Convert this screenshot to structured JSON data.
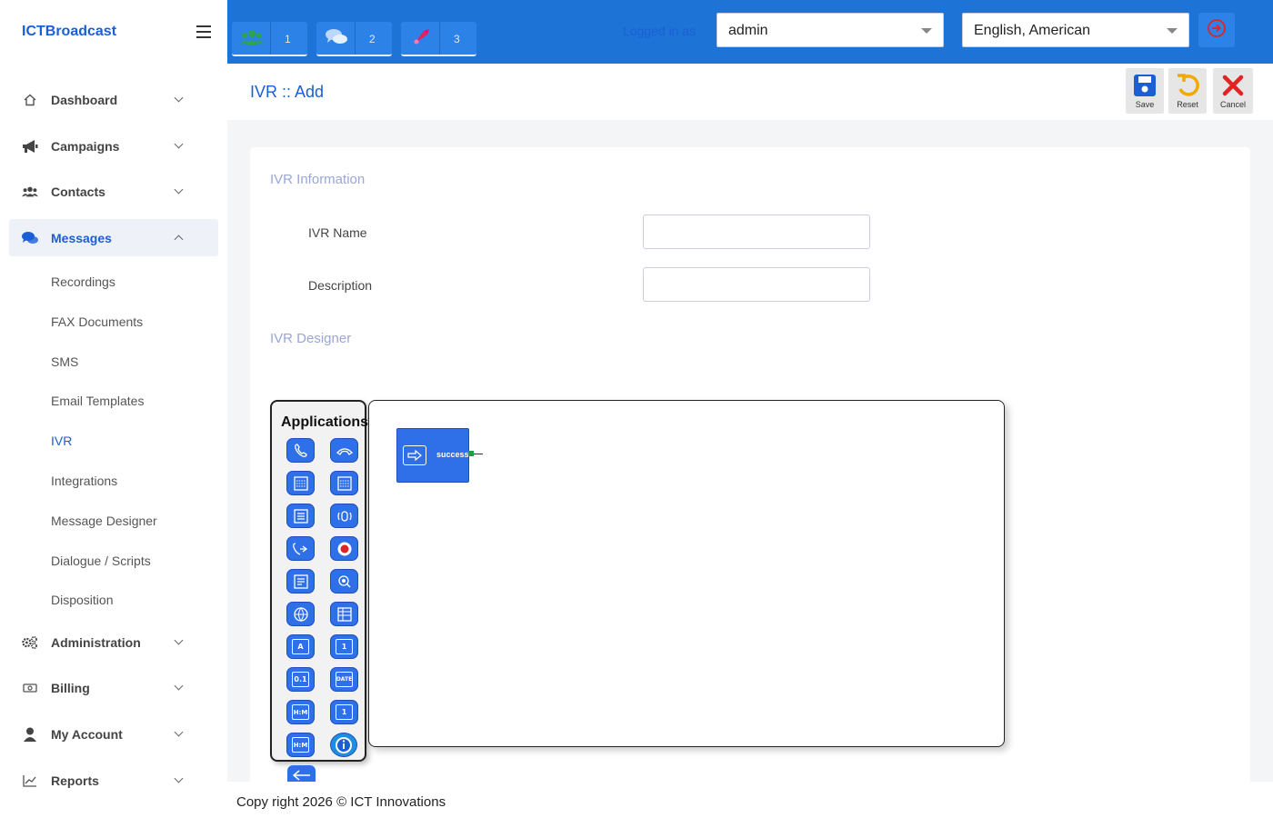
{
  "brand": "ICTBroadcast",
  "sidebar": {
    "items": [
      {
        "label": "Dashboard"
      },
      {
        "label": "Campaigns"
      },
      {
        "label": "Contacts"
      },
      {
        "label": "Messages"
      },
      {
        "label": "Administration"
      },
      {
        "label": "Billing"
      },
      {
        "label": "My Account"
      },
      {
        "label": "Reports"
      }
    ],
    "sub_items": [
      "Recordings",
      "FAX Documents",
      "SMS",
      "Email Templates",
      "IVR",
      "Integrations",
      "Message Designer",
      "Dialogue / Scripts",
      "Disposition"
    ]
  },
  "topbar": {
    "counters": [
      "1",
      "2",
      "3"
    ],
    "logged_in_label": "Logged in as",
    "user_select": "admin",
    "language_select": "English, American"
  },
  "header": {
    "title": "IVR :: Add",
    "save_label": "Save",
    "reset_label": "Reset",
    "cancel_label": "Cancel"
  },
  "form": {
    "section_info": "IVR Information",
    "name_label": "IVR Name",
    "name_value": "",
    "description_label": "Description",
    "description_value": "",
    "section_designer": "IVR Designer"
  },
  "designer": {
    "palette_title": "Applications",
    "icon_labels": [
      "A",
      "1",
      "0.1",
      "DATE",
      "H:M",
      "1",
      "H:M"
    ],
    "start_node_label": "success"
  },
  "footer": {
    "text": "Copy right 2026 © ICT Innovations"
  },
  "colors": {
    "primary": "#1e73d6",
    "accent": "#1a5fd6",
    "node": "#2f6fe8",
    "save": "#1a5fd6",
    "reset": "#f2a900",
    "cancel": "#e02424"
  }
}
